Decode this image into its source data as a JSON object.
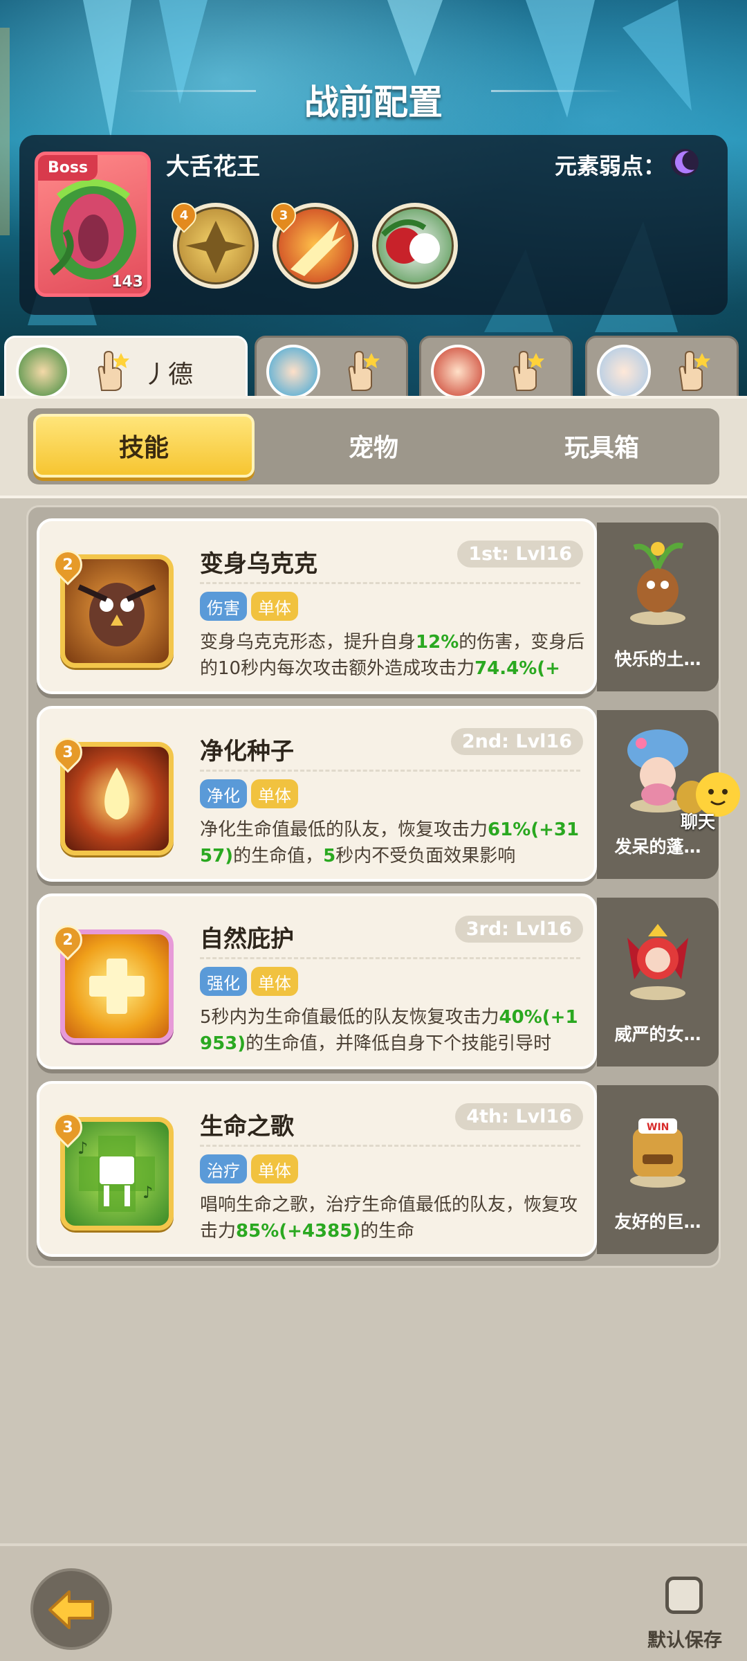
{
  "title": "战前配置",
  "boss": {
    "tag": "Boss",
    "level": "143",
    "name": "大舌花王",
    "weak_label": "元素弱点：",
    "weak_icon": "moon-icon",
    "skills": [
      {
        "level": "4",
        "icon": "claw-strike-icon"
      },
      {
        "level": "3",
        "icon": "fire-slash-icon"
      },
      {
        "level": "",
        "icon": "vine-bite-icon"
      }
    ]
  },
  "heroes": [
    {
      "name": "丿德",
      "icon": "druid-hero-avatar",
      "active": true
    },
    {
      "name": "",
      "icon": "blue-hair-hero-avatar",
      "active": false
    },
    {
      "name": "",
      "icon": "red-hair-hero-avatar",
      "active": false
    },
    {
      "name": "",
      "icon": "silver-hair-hero-avatar",
      "active": false
    }
  ],
  "tabs": [
    {
      "label": "技能",
      "active": true
    },
    {
      "label": "宠物",
      "active": false
    },
    {
      "label": "玩具箱",
      "active": false
    }
  ],
  "skills": [
    {
      "name": "变身乌克克",
      "level_badge": "1st: Lvl16",
      "cost": "2",
      "icon": "owl-transform-icon",
      "tags": [
        "伤害",
        "单体"
      ],
      "desc": [
        "变身乌克克形态，提升自身",
        "12%",
        "的伤害，变身后的10秒内每次攻击额外造成攻击力",
        "74.4%(+",
        "…"
      ],
      "pet": "快乐的土…"
    },
    {
      "name": "净化种子",
      "level_badge": "2nd: Lvl16",
      "cost": "3",
      "icon": "purify-seed-icon",
      "tags": [
        "净化",
        "单体"
      ],
      "desc": [
        "净化生命值最低的队友，恢复攻击力",
        "61%(+3157)",
        "的生命值，",
        "5",
        "秒内不受负面效果影响"
      ],
      "pet": "发呆的蓬…"
    },
    {
      "name": "自然庇护",
      "level_badge": "3rd: Lvl16",
      "cost": "2",
      "icon": "nature-shield-icon",
      "tags": [
        "强化",
        "单体"
      ],
      "desc": [
        "5秒内为生命值最低的队友恢复攻击力",
        "40%(+1953)",
        "的生命值，并降低自身下个技能引导时",
        "",
        "…"
      ],
      "pet": "威严的女…"
    },
    {
      "name": "生命之歌",
      "level_badge": "4th: Lvl16",
      "cost": "3",
      "icon": "life-song-icon",
      "tags": [
        "治疗",
        "单体"
      ],
      "desc": [
        "唱响生命之歌，治疗生命值最低的队友，恢复攻击力",
        "85%(+4385)",
        "的生命",
        "",
        ""
      ],
      "pet": "友好的巨…"
    }
  ],
  "chat": {
    "label": "聊天"
  },
  "footer": {
    "save_label": "默认保存",
    "back_icon": "back-arrow-icon"
  }
}
